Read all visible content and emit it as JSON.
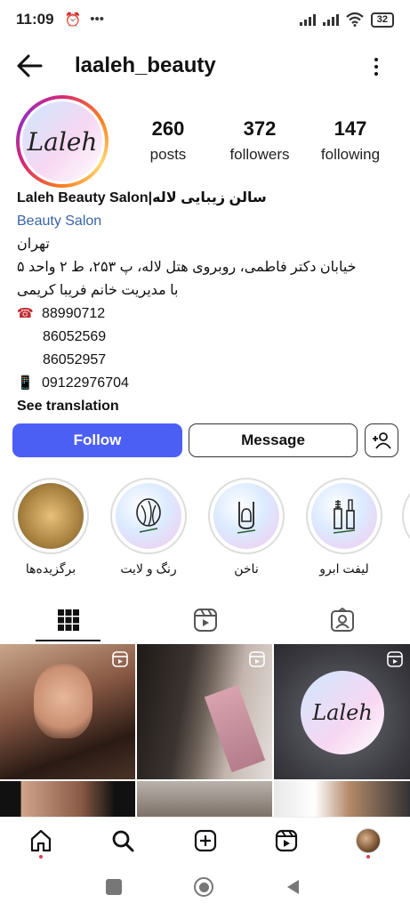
{
  "status_bar": {
    "time": "11:09",
    "battery": "32"
  },
  "header": {
    "username": "laaleh_beauty"
  },
  "profile": {
    "avatar_text": "Laleh",
    "stats": [
      {
        "value": "260",
        "label": "posts"
      },
      {
        "value": "372",
        "label": "followers"
      },
      {
        "value": "147",
        "label": "following"
      }
    ]
  },
  "bio": {
    "name": "Laleh Beauty Salon|سالن زیبایی لاله",
    "category": "Beauty Salon",
    "line1": "تهران",
    "line2": "خیابان دکتر فاطمی، روبروی هتل لاله، پ ۲۵۳، ط ۲ واحد ۵",
    "line3": "با مدیریت خانم فریبا کریمی",
    "phone1": "88990712",
    "phone2": "86052569",
    "phone3": "86052957",
    "mobile": "09122976704",
    "see_translation": "See translation"
  },
  "buttons": {
    "follow": "Follow",
    "message": "Message"
  },
  "highlights": [
    {
      "label": "برگزیده‌ها",
      "icon": "food-photo"
    },
    {
      "label": "رنگ و لایت",
      "icon": "hair-icon"
    },
    {
      "label": "ناخن",
      "icon": "nail-icon"
    },
    {
      "label": "لیفت ابرو",
      "icon": "mascara-icon"
    }
  ],
  "colors": {
    "follow_button": "#4c5ff5",
    "category_link": "#3a64a8",
    "notification_dot": "#e23b55"
  }
}
